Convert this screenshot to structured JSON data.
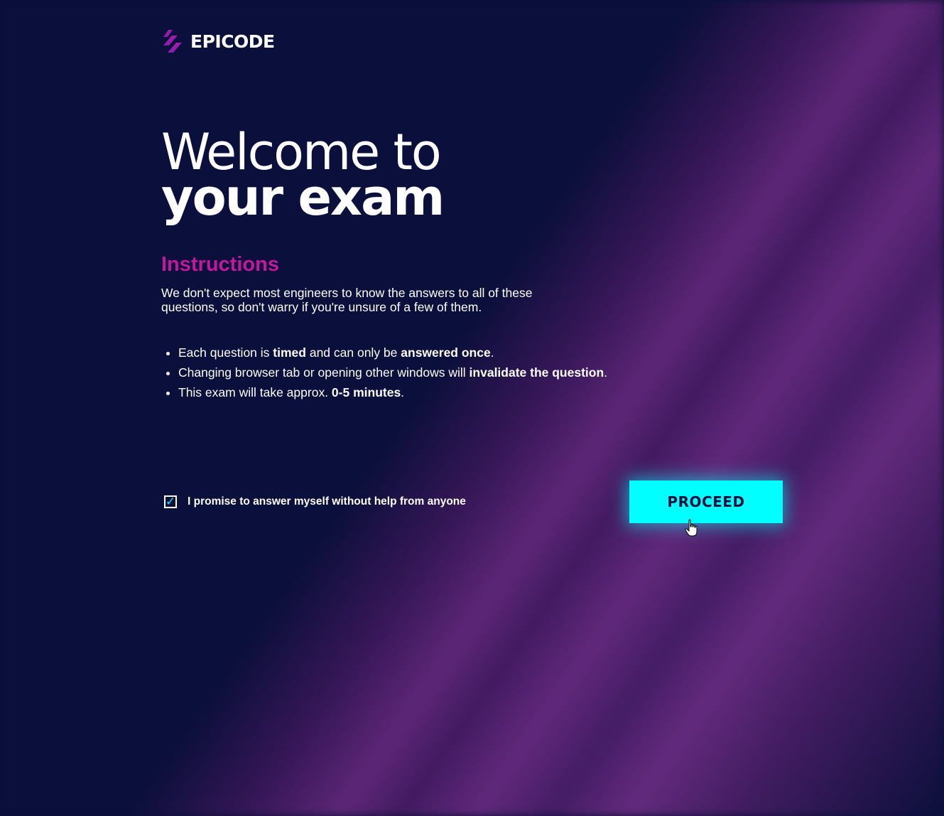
{
  "brand": {
    "name": "EPICODE",
    "logo_icon": "epicode-logo-icon"
  },
  "hero": {
    "line1": "Welcome to",
    "line2": "your exam"
  },
  "instructions": {
    "heading": "Instructions",
    "intro": "We don't expect most engineers to know the answers to all of these questions, so don't warry if you're unsure of a few of them.",
    "rules": [
      {
        "parts": [
          "Each question is ",
          "timed",
          " and can only be ",
          "answered once",
          "."
        ]
      },
      {
        "parts": [
          "Changing browser tab or opening other windows will ",
          "invalidate the question",
          "."
        ]
      },
      {
        "parts": [
          "This exam will take approx. ",
          "0-5 minutes",
          "."
        ]
      }
    ]
  },
  "promise": {
    "checked": true,
    "label": "I promise to answer myself without help from anyone"
  },
  "proceed_button": {
    "label": "PROCEED"
  },
  "colors": {
    "background": "#0b0f3b",
    "accent_magenta": "#c2189c",
    "accent_cyan": "#00ffff",
    "text": "#ffffff"
  }
}
